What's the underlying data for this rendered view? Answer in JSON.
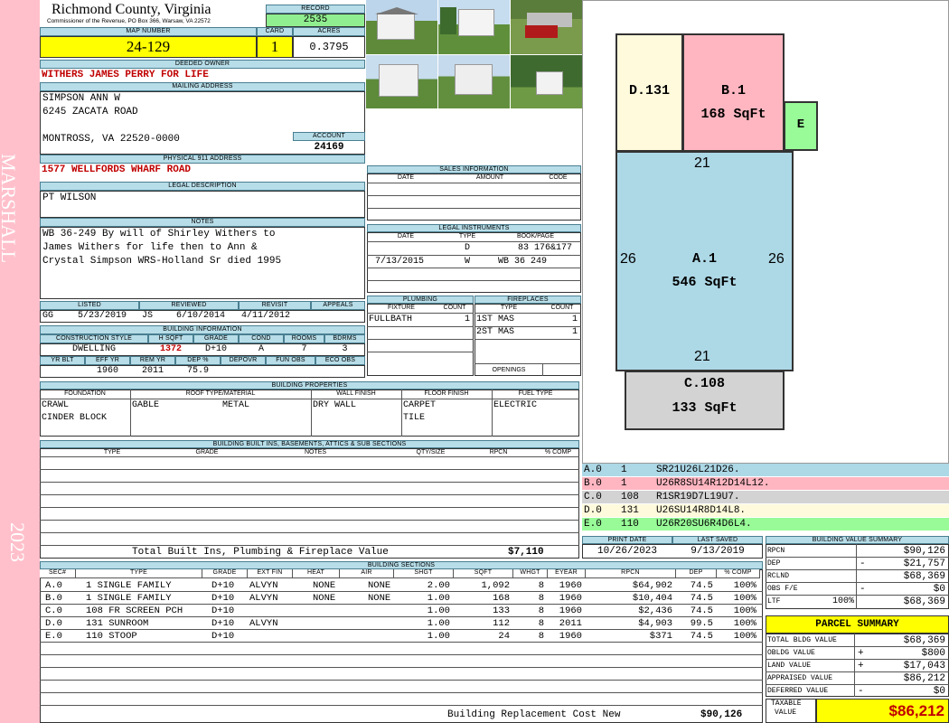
{
  "side": {
    "left_label": "MARSHALL",
    "year": "2023"
  },
  "header": {
    "county": "Richmond County, Virginia",
    "commissioner": "Commissioner of the Revenue, PO Box 366, Warsaw, VA 22572",
    "record_label": "RECORD",
    "record": "2535",
    "map_label": "MAP NUMBER",
    "map_number": "24-129",
    "card_label": "CARD",
    "card": "1",
    "acres_label": "ACRES",
    "acres": "0.3795"
  },
  "owner": {
    "deeded_label": "DEEDED OWNER",
    "deeded_owner": "WITHERS JAMES PERRY FOR LIFE",
    "mailing_label": "MAILING ADDRESS",
    "mail_line1": "SIMPSON ANN W",
    "mail_line2": "6245 ZACATA ROAD",
    "mail_line3": "MONTROSS, VA 22520-0000",
    "account_label": "ACCOUNT",
    "account": "24169",
    "physical_label": "PHYSICAL 911 ADDRESS",
    "physical_address": "1577 WELLFORDS WHARF ROAD",
    "legal_label": "LEGAL DESCRIPTION",
    "legal": "PT WILSON",
    "notes_label": "NOTES",
    "notes_line1": "WB 36-249 By will of Shirley Withers to",
    "notes_line2": "James Withers for life then to Ann &",
    "notes_line3": "Crystal Simpson WRS-Holland Sr died 1995"
  },
  "listing": {
    "listed_label": "LISTED",
    "reviewed_label": "REVIEWED",
    "revisit_label": "REVISIT",
    "appeals_label": "APPEALS",
    "listed_by": "GG",
    "listed_date": "5/23/2019",
    "reviewed_by": "JS",
    "reviewed_date": "6/10/2014",
    "revisit": "4/11/2012"
  },
  "building_info": {
    "label": "BUILDING INFORMATION",
    "h": [
      "CONSTRUCTION STYLE",
      "H SQFT",
      "GRADE",
      "COND",
      "ROOMS",
      "BDRMS"
    ],
    "style": "DWELLING",
    "hsqft": "1372",
    "grade": "D+10",
    "cond": "A",
    "rooms": "7",
    "bdrms": "3",
    "h2": [
      "YR BLT",
      "EFF YR",
      "REM YR",
      "DEP %",
      "DEPOVR",
      "FUN OBS",
      "ECO OBS"
    ],
    "eff_yr": "1960",
    "rem_yr": "2011",
    "dep": "75.9"
  },
  "sales": {
    "label": "SALES INFORMATION",
    "date_h": "DATE",
    "amount_h": "AMOUNT",
    "code_h": "CODE"
  },
  "legal_instruments": {
    "label": "LEGAL INSTRUMENTS",
    "date_h": "DATE",
    "type_h": "TYPE",
    "book_h": "BOOK/PAGE",
    "rows": [
      {
        "date": "",
        "type": "D",
        "book": "83 176&177"
      },
      {
        "date": "7/13/2015",
        "type": "W",
        "book": "WB 36 249"
      }
    ]
  },
  "plumbing": {
    "label": "PLUMBING",
    "fixture_h": "FIXTURE",
    "count_h": "COUNT",
    "fixture": "FULLBATH",
    "count": "1"
  },
  "fireplaces": {
    "label": "FIREPLACES",
    "type_h": "TYPE",
    "count_h": "COUNT",
    "openings_label": "OPENINGS",
    "rows": [
      {
        "type": "1ST MAS",
        "count": "1"
      },
      {
        "type": "2ST MAS",
        "count": "1"
      }
    ]
  },
  "properties": {
    "label": "BUILDING PROPERTIES",
    "foundation_h": "FOUNDATION",
    "roof_h": "ROOF TYPE/MATERIAL",
    "wall_h": "WALL FINISH",
    "floor_h": "FLOOR FINISH",
    "fuel_h": "FUEL TYPE",
    "foundation1": "CRAWL",
    "foundation2": "CINDER BLOCK",
    "roof_type": "GABLE",
    "roof_material": "METAL",
    "wall": "DRY WALL",
    "floor1": "CARPET",
    "floor2": "TILE",
    "fuel": "ELECTRIC"
  },
  "builtins": {
    "label": "BUILDING BUILT INS, BASEMENTS, ATTICS & SUB SECTIONS",
    "h": [
      "TYPE",
      "GRADE",
      "NOTES",
      "QTY/SIZE",
      "RPCN",
      "% COMP"
    ],
    "total_label": "Total Built Ins, Plumbing & Fireplace Value",
    "total": "$7,110"
  },
  "print": {
    "print_label": "PRINT DATE",
    "print_date": "10/26/2023",
    "saved_label": "LAST SAVED",
    "saved_date": "9/13/2019"
  },
  "sections": {
    "label": "BUILDING SECTIONS",
    "h": [
      "SEC#",
      "TYPE",
      "GRADE",
      "EXT FIN",
      "HEAT",
      "AIR",
      "SHGT",
      "SQFT",
      "WHGT",
      "EYEAR",
      "RPCN",
      "DEP",
      "% COMP"
    ],
    "rows": [
      {
        "sec": "A.0",
        "type": "1 SINGLE FAMILY",
        "grade": "D+10",
        "ext": "ALVYN",
        "heat": "NONE",
        "air": "NONE",
        "shgt": "2.00",
        "sqft": "1,092",
        "whgt": "8",
        "eyear": "1960",
        "rpcn": "$64,902",
        "dep": "74.5",
        "comp": "100%"
      },
      {
        "sec": "B.0",
        "type": "1 SINGLE FAMILY",
        "grade": "D+10",
        "ext": "ALVYN",
        "heat": "NONE",
        "air": "NONE",
        "shgt": "1.00",
        "sqft": "168",
        "whgt": "8",
        "eyear": "1960",
        "rpcn": "$10,404",
        "dep": "74.5",
        "comp": "100%"
      },
      {
        "sec": "C.0",
        "type": "108 FR SCREEN PCH",
        "grade": "D+10",
        "ext": "",
        "heat": "",
        "air": "",
        "shgt": "1.00",
        "sqft": "133",
        "whgt": "8",
        "eyear": "1960",
        "rpcn": "$2,436",
        "dep": "74.5",
        "comp": "100%"
      },
      {
        "sec": "D.0",
        "type": "131 SUNROOM",
        "grade": "D+10",
        "ext": "ALVYN",
        "heat": "",
        "air": "",
        "shgt": "1.00",
        "sqft": "112",
        "whgt": "8",
        "eyear": "2011",
        "rpcn": "$4,903",
        "dep": "99.5",
        "comp": "100%"
      },
      {
        "sec": "E.0",
        "type": "110 STOOP",
        "grade": "D+10",
        "ext": "",
        "heat": "",
        "air": "",
        "shgt": "1.00",
        "sqft": "24",
        "whgt": "8",
        "eyear": "1960",
        "rpcn": "$371",
        "dep": "74.5",
        "comp": "100%"
      }
    ],
    "total_label": "Building Replacement Cost New",
    "total": "$90,126"
  },
  "sketch": {
    "d_label": "D.131",
    "b_label": "B.1",
    "b_area": "168 SqFt",
    "e_label": "E",
    "a_label": "A.1",
    "a_area": "546 SqFt",
    "top_dim": "21",
    "bottom_dim": "21",
    "left_dim": "26",
    "right_dim": "26",
    "c_label": "C.108",
    "c_area": "133 SqFt",
    "legend": [
      {
        "sec": "A.0",
        "code": "1",
        "path": "SR21U26L21D26.",
        "color": "#add8e6"
      },
      {
        "sec": "B.0",
        "code": "1",
        "path": "U26R8SU14R12D14L12.",
        "color": "#ffb6c1"
      },
      {
        "sec": "C.0",
        "code": "108",
        "path": "R1SR19D7L19U7.",
        "color": "#d3d3d3"
      },
      {
        "sec": "D.0",
        "code": "131",
        "path": "U26SU14R8D14L8.",
        "color": "#fffadc"
      },
      {
        "sec": "E.0",
        "code": "110",
        "path": "U26R20SU6R4D6L4.",
        "color": "#98fb98"
      }
    ]
  },
  "value_summary": {
    "label": "BUILDING VALUE SUMMARY",
    "rpcn_l": "RPCN",
    "rpcn": "$90,126",
    "dep_l": "DEP",
    "dep_sign": "-",
    "dep": "$21,757",
    "rclnd_l": "RCLND",
    "rclnd": "$68,369",
    "obs_l": "OBS F/E",
    "obs_sign": "-",
    "obs": "$0",
    "ltr_l": "LTF",
    "ltr_pct": "100%",
    "ltr": "$68,369"
  },
  "parcel": {
    "label": "PARCEL SUMMARY",
    "total_bldg_l": "TOTAL BLDG VALUE",
    "total_bldg": "$68,369",
    "obldg_l": "OBLDG VALUE",
    "obldg_sign": "+",
    "obldg": "$800",
    "land_l": "LAND VALUE",
    "land_sign": "+",
    "land": "$17,043",
    "appraised_l": "APPRAISED VALUE",
    "appraised": "$86,212",
    "deferred_l": "DEFERRED VALUE",
    "deferred_sign": "-",
    "deferred": "$0",
    "taxable_l1": "TAXABLE",
    "taxable_l2": "VALUE",
    "taxable": "$86,212"
  },
  "colors": {
    "side": "#ffc0cb",
    "header": "#b7dde8",
    "yellow": "#ffff00",
    "green": "#90ee90"
  }
}
